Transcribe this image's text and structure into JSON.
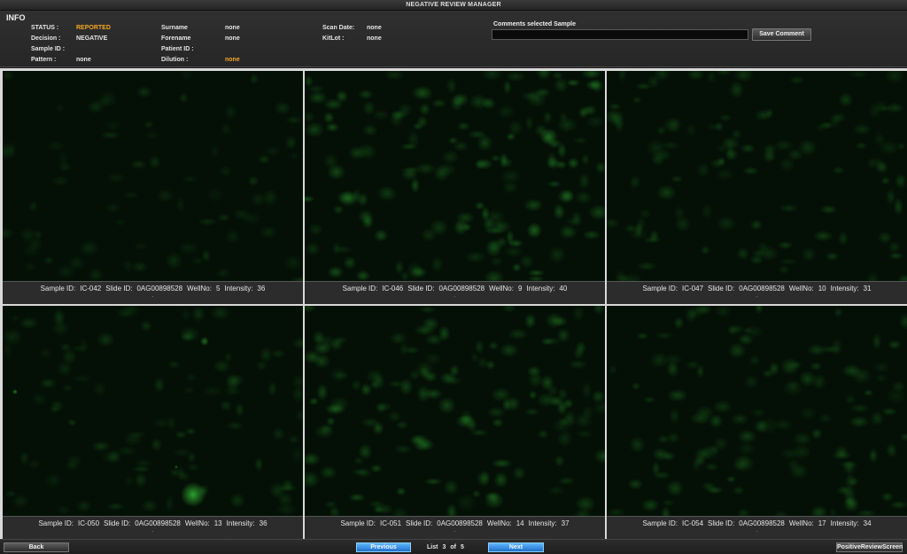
{
  "window": {
    "title": "NEGATIVE REVIEW MANAGER"
  },
  "info": {
    "heading": "INFO",
    "fields": {
      "status_label": "STATUS :",
      "status_value": "REPORTED",
      "decision_label": "Decision :",
      "decision_value": "NEGATIVE",
      "sample_id_label": "Sample ID :",
      "sample_id_value": "",
      "pattern_label": "Pattern :",
      "pattern_value": "none",
      "surname_label": "Surname",
      "surname_value": "none",
      "forename_label": "Forename",
      "forename_value": "none",
      "patient_id_label": "Patient ID :",
      "patient_id_value": "",
      "dilution_label": "Dilution :",
      "dilution_value": "none",
      "scan_date_label": "Scan Date:",
      "scan_date_value": "none",
      "kitlot_label": "KitLot :",
      "kitlot_value": "none"
    },
    "comments_label": "Comments selected Sample",
    "comment_value": "",
    "save_button": "Save Comment"
  },
  "samples": [
    {
      "sample_id_label": "Sample ID:",
      "sample_id": "IC-042",
      "slide_id_label": "Slide ID:",
      "slide_id": "0AG00898528",
      "well_label": "WellNo:",
      "well": "5",
      "intensity_label": "Intensity:",
      "intensity": "36",
      "dot": "."
    },
    {
      "sample_id_label": "Sample ID:",
      "sample_id": "IC-046",
      "slide_id_label": "Slide ID:",
      "slide_id": "0AG00898528",
      "well_label": "WellNo:",
      "well": "9",
      "intensity_label": "Intensity:",
      "intensity": "40",
      "dot": "."
    },
    {
      "sample_id_label": "Sample ID:",
      "sample_id": "IC-047",
      "slide_id_label": "Slide ID:",
      "slide_id": "0AG00898528",
      "well_label": "WellNo:",
      "well": "10",
      "intensity_label": "Intensity:",
      "intensity": "31",
      "dot": "."
    },
    {
      "sample_id_label": "Sample ID:",
      "sample_id": "IC-050",
      "slide_id_label": "Slide ID:",
      "slide_id": "0AG00898528",
      "well_label": "WellNo:",
      "well": "13",
      "intensity_label": "Intensity:",
      "intensity": "36",
      "dot": "."
    },
    {
      "sample_id_label": "Sample ID:",
      "sample_id": "IC-051",
      "slide_id_label": "Slide ID:",
      "slide_id": "0AG00898528",
      "well_label": "WellNo:",
      "well": "14",
      "intensity_label": "Intensity:",
      "intensity": "37",
      "dot": "."
    },
    {
      "sample_id_label": "Sample ID:",
      "sample_id": "IC-054",
      "slide_id_label": "Slide ID:",
      "slide_id": "0AG00898528",
      "well_label": "WellNo:",
      "well": "17",
      "intensity_label": "Intensity:",
      "intensity": "34",
      "dot": "."
    }
  ],
  "footer": {
    "back_button": "Back",
    "previous_button": "Previous",
    "list_label": "List",
    "current_page": "3",
    "of_label": "of",
    "total_pages": "5",
    "next_button": "Next",
    "positive_review_button": "PositiveReviewScreen"
  },
  "colors": {
    "status_value": "#f5a623",
    "dilution_value": "#f5a623",
    "nav_button": "#2f8fe8",
    "fluorescence": "#2fa830"
  }
}
